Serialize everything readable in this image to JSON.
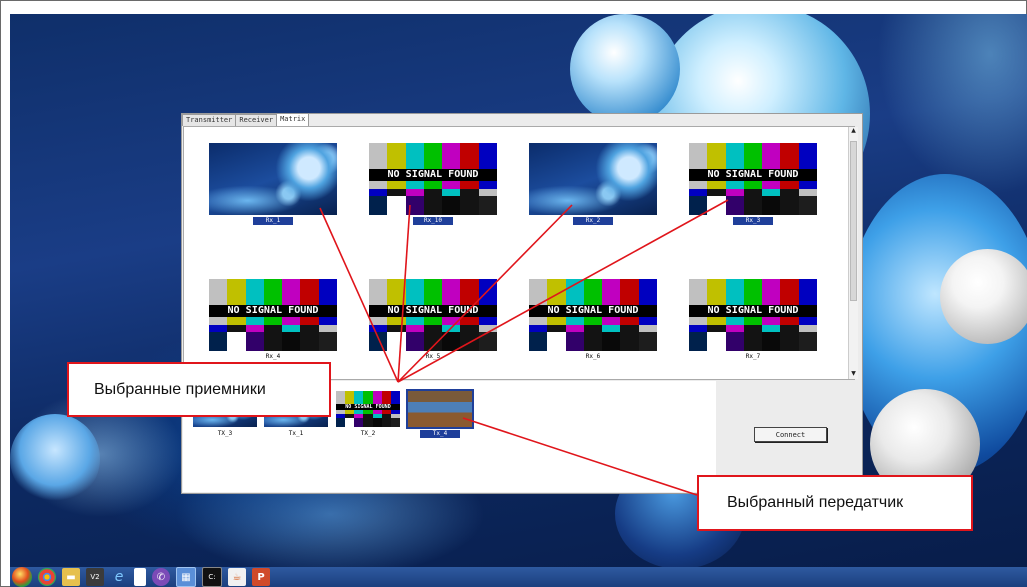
{
  "tabs": [
    "Transmitter",
    "Receiver",
    "Matrix"
  ],
  "active_tab": "Matrix",
  "receivers": [
    {
      "label": "Rx_1",
      "preview": "wallpaper",
      "selected": true
    },
    {
      "label": "Rx_10",
      "preview": "no-signal",
      "selected": true
    },
    {
      "label": "Rx_2",
      "preview": "wallpaper",
      "selected": true
    },
    {
      "label": "Rx_3",
      "preview": "no-signal",
      "selected": true
    },
    {
      "label": "Rx_4",
      "preview": "no-signal",
      "selected": false
    },
    {
      "label": "Rx_5",
      "preview": "no-signal",
      "selected": false
    },
    {
      "label": "Rx_6",
      "preview": "no-signal",
      "selected": false
    },
    {
      "label": "Rx_7",
      "preview": "no-signal",
      "selected": false
    }
  ],
  "no_signal_text": "NO SIGNAL FOUND",
  "transmitters": [
    {
      "label": "TX_3",
      "preview": "wallpaper",
      "selected": false
    },
    {
      "label": "Tx_1",
      "preview": "wallpaper",
      "selected": false
    },
    {
      "label": "TX_2",
      "preview": "no-signal",
      "selected": false
    },
    {
      "label": "Tx_4",
      "preview": "photo",
      "selected": true
    }
  ],
  "connect_label": "Connect",
  "callouts": {
    "receivers": "Выбранные приемники",
    "transmitter": "Выбранный передатчик"
  },
  "colors": {
    "callout_border": "#e0151b",
    "selection": "#1f3f9a"
  },
  "taskbar_icons": [
    "windows-start-icon",
    "chrome-icon",
    "file-explorer-icon",
    "vnc-icon",
    "internet-explorer-icon",
    "notepad-icon",
    "viber-icon",
    "control-panel-icon",
    "cmd-icon",
    "java-icon",
    "powerpoint-icon"
  ]
}
